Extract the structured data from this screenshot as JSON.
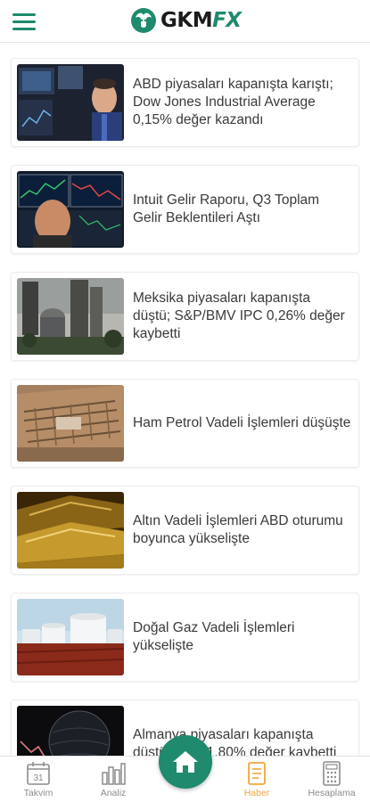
{
  "header": {
    "brand_main": "GKM",
    "brand_accent": "FX",
    "accent_color": "#1f8a6d"
  },
  "news": [
    {
      "title": "ABD piyasaları kapanışta karıştı; Dow Jones Industrial Average 0,15% değer kazandı",
      "image": "trader-screens"
    },
    {
      "title": "Intuit Gelir Raporu, Q3 Toplam Gelir Beklentileri Aştı",
      "image": "trader-charts"
    },
    {
      "title": "Meksika piyasaları kapanışta düştü; S&P/BMV IPC 0,26% değer kaybetti",
      "image": "city-skyline"
    },
    {
      "title": "Ham Petrol Vadeli İşlemleri düşüşte",
      "image": "oil-field"
    },
    {
      "title": "Altın Vadeli İşlemleri ABD oturumu boyunca yükselişte",
      "image": "gold-bars"
    },
    {
      "title": "Doğal Gaz Vadeli İşlemleri yükselişte",
      "image": "gas-tanks"
    },
    {
      "title": "Almanya piyasaları kapanışta düştü; DAX 1,80% değer kaybetti",
      "image": "globe-chart"
    }
  ],
  "bottom_nav": {
    "calendar_day": "31",
    "items": [
      {
        "label": "Takvim",
        "icon": "calendar-icon"
      },
      {
        "label": "Analiz",
        "icon": "bar-chart-icon"
      },
      {
        "label": "Haber",
        "icon": "news-icon",
        "active": true
      },
      {
        "label": "Hesaplama",
        "icon": "calculator-icon"
      }
    ],
    "home_icon": "home-icon",
    "active_color": "#f0a63b"
  }
}
